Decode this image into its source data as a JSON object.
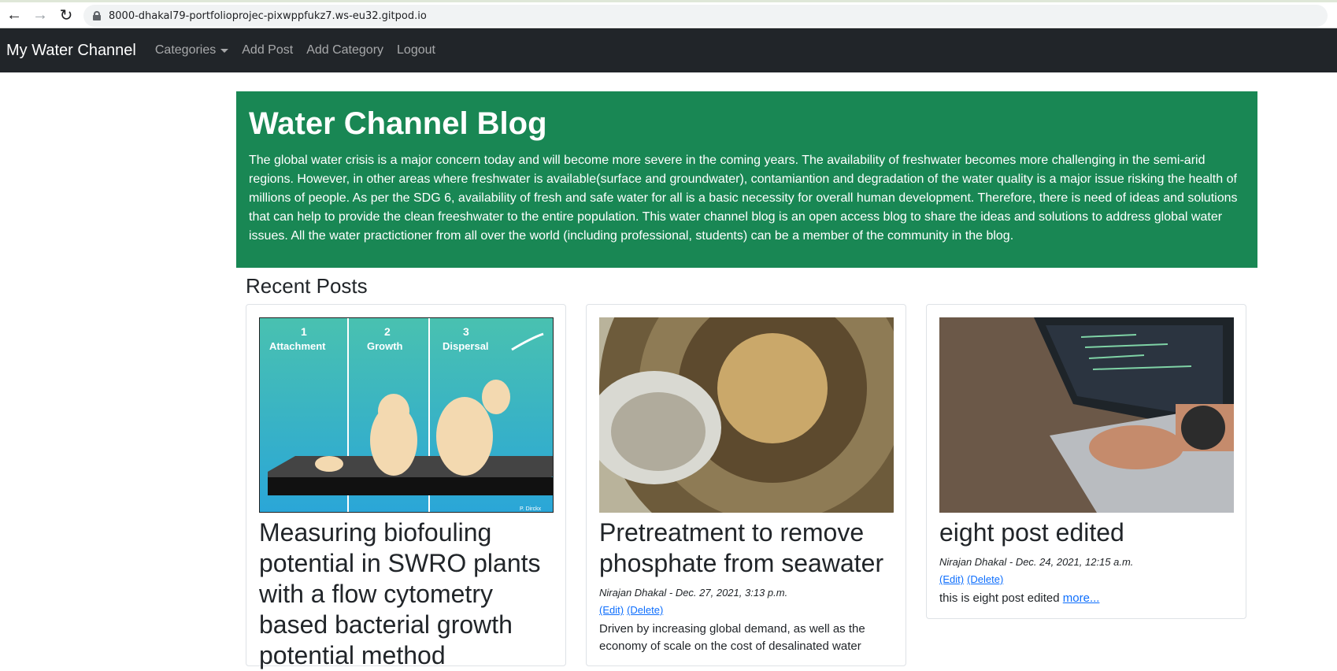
{
  "browser": {
    "url": "8000-dhakal79-portfolioprojec-pixwppfukz7.ws-eu32.gitpod.io"
  },
  "navbar": {
    "brand": "My Water Channel",
    "links": [
      "Categories",
      "Add Post",
      "Add Category",
      "Logout"
    ]
  },
  "hero": {
    "title": "Water Channel Blog",
    "text": "The global water crisis is a major concern today and will become more severe in the coming years. The availability of freshwater becomes more challenging in the semi-arid regions. However, in other areas where freshwater is available(surface and groundwater), contamiantion and degradation of the water quality is a major issue risking the health of millions of people. As per the SDG 6, availability of fresh and safe water for all is a basic necessity for overall human development. Therefore, there is need of ideas and solutions that can help to provide the clean freeshwater to the entire population. This water channel blog is an open access blog to share the ideas and solutions to address global water issues. All the water practictioner from all over the world (including professional, students) can be a member of the community in the blog."
  },
  "recent_title": "Recent Posts",
  "posts": [
    {
      "title": "Measuring biofouling potential in SWRO plants with a flow cytometry based bacterial growth potential method",
      "image_labels": [
        "1",
        "Attachment",
        "2",
        "Growth",
        "3",
        "Dispersal",
        "P. Dirckx"
      ]
    },
    {
      "title": "Pretreatment to remove phosphate from seawater",
      "meta": "Nirajan Dhakal - Dec. 27, 2021, 3:13 p.m.",
      "edit": "(Edit)",
      "delete": "(Delete)",
      "excerpt": "Driven by increasing global demand, as well as the economy of scale on the cost of desalinated water"
    },
    {
      "title": "eight post edited",
      "meta": "Nirajan Dhakal - Dec. 24, 2021, 12:15 a.m.",
      "edit": "(Edit)",
      "delete": "(Delete)",
      "excerpt": "this is eight post edited",
      "more": "more..."
    }
  ],
  "colors": {
    "navbar": "#212529",
    "hero": "#198754",
    "link": "#0d6efd"
  }
}
